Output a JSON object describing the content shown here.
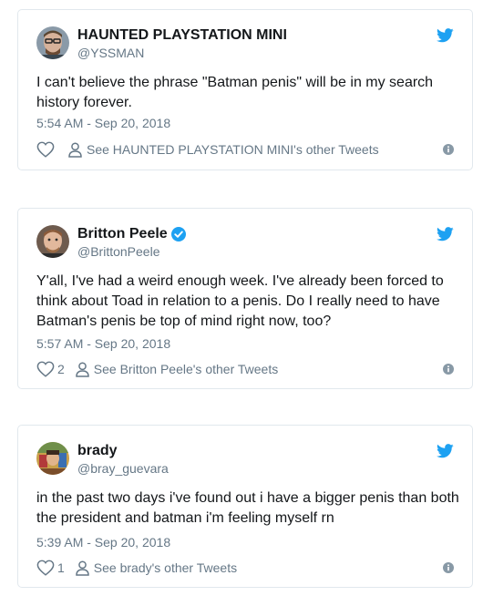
{
  "colors": {
    "twitter_blue": "#1da1f2",
    "text": "#14171a",
    "muted": "#657786",
    "border": "#e1e8ed"
  },
  "tweets": [
    {
      "display_name": "HAUNTED PLAYSTATION MINI",
      "handle": "@YSSMAN",
      "verified": false,
      "text": "I can't believe the phrase \"Batman penis\" will be in my search history forever.",
      "timestamp": "5:54 AM - Sep 20, 2018",
      "like_count": "",
      "others_label": "See HAUNTED PLAYSTATION MINI's other Tweets",
      "icons": [
        "avatar",
        "twitter-bird-icon",
        "heart-icon",
        "person-icon",
        "info-icon"
      ]
    },
    {
      "display_name": "Britton Peele",
      "handle": "@BrittonPeele",
      "verified": true,
      "text": "Y'all, I've had a weird enough week. I've already been forced to think about Toad in relation to a penis. Do I really need to have Batman's penis be top of mind right now, too?",
      "timestamp": "5:57 AM - Sep 20, 2018",
      "like_count": "2",
      "others_label": "See Britton Peele's other Tweets",
      "icons": [
        "avatar",
        "verified-badge-icon",
        "twitter-bird-icon",
        "heart-icon",
        "person-icon",
        "info-icon"
      ]
    },
    {
      "display_name": "brady",
      "handle": "@bray_guevara",
      "verified": false,
      "text": "in the past two days i've found out i have a bigger penis than both the president and batman i'm feeling myself rn",
      "timestamp": "5:39 AM - Sep 20, 2018",
      "like_count": "1",
      "others_label": "See brady's other Tweets",
      "icons": [
        "avatar",
        "twitter-bird-icon",
        "heart-icon",
        "person-icon",
        "info-icon"
      ]
    }
  ]
}
